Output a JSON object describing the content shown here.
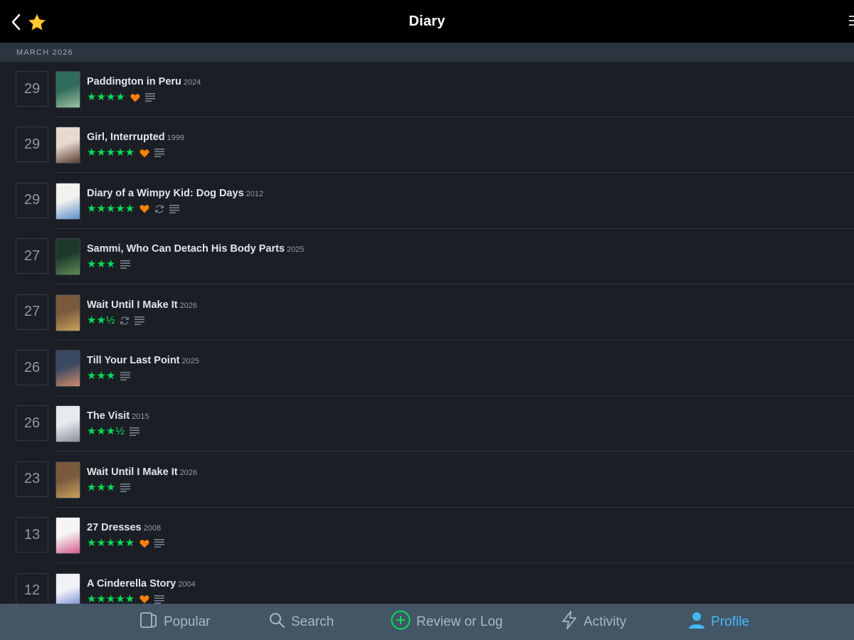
{
  "header": {
    "title": "Diary"
  },
  "section": {
    "label": "MARCH 2026"
  },
  "colors": {
    "stars": "#00e054",
    "heart": "#ff8000",
    "active_tab": "#40bcf4"
  },
  "entries": [
    {
      "day": "29",
      "title": "Paddington in Peru",
      "year": "2024",
      "rating": 4,
      "stars": "★★★★",
      "liked": true,
      "rewatch": false,
      "review": true
    },
    {
      "day": "29",
      "title": "Girl, Interrupted",
      "year": "1999",
      "rating": 5,
      "stars": "★★★★★",
      "liked": true,
      "rewatch": false,
      "review": true
    },
    {
      "day": "29",
      "title": "Diary of a Wimpy Kid: Dog Days",
      "year": "2012",
      "rating": 5,
      "stars": "★★★★★",
      "liked": true,
      "rewatch": true,
      "review": true
    },
    {
      "day": "27",
      "title": "Sammi, Who Can Detach His Body Parts",
      "year": "2025",
      "rating": 3,
      "stars": "★★★",
      "liked": false,
      "rewatch": false,
      "review": true
    },
    {
      "day": "27",
      "title": "Wait Until I Make It",
      "year": "2026",
      "rating": 2.5,
      "stars": "★★½",
      "liked": false,
      "rewatch": true,
      "review": true
    },
    {
      "day": "26",
      "title": "Till Your Last Point",
      "year": "2025",
      "rating": 3,
      "stars": "★★★",
      "liked": false,
      "rewatch": false,
      "review": true
    },
    {
      "day": "26",
      "title": "The Visit",
      "year": "2015",
      "rating": 3.5,
      "stars": "★★★½",
      "liked": false,
      "rewatch": false,
      "review": true
    },
    {
      "day": "23",
      "title": "Wait Until I Make It",
      "year": "2026",
      "rating": 3,
      "stars": "★★★",
      "liked": false,
      "rewatch": false,
      "review": true
    },
    {
      "day": "13",
      "title": "27 Dresses",
      "year": "2008",
      "rating": 5,
      "stars": "★★★★★",
      "liked": true,
      "rewatch": false,
      "review": true
    },
    {
      "day": "12",
      "title": "A Cinderella Story",
      "year": "2004",
      "rating": 5,
      "stars": "★★★★★",
      "liked": true,
      "rewatch": false,
      "review": true
    }
  ],
  "tabs": [
    {
      "label": "Popular",
      "icon": "popular-icon",
      "active": false
    },
    {
      "label": "Search",
      "icon": "search-icon",
      "active": false
    },
    {
      "label": "Review or Log",
      "icon": "plus-circle-icon",
      "active": false
    },
    {
      "label": "Activity",
      "icon": "lightning-icon",
      "active": false
    },
    {
      "label": "Profile",
      "icon": "profile-icon",
      "active": true
    }
  ]
}
